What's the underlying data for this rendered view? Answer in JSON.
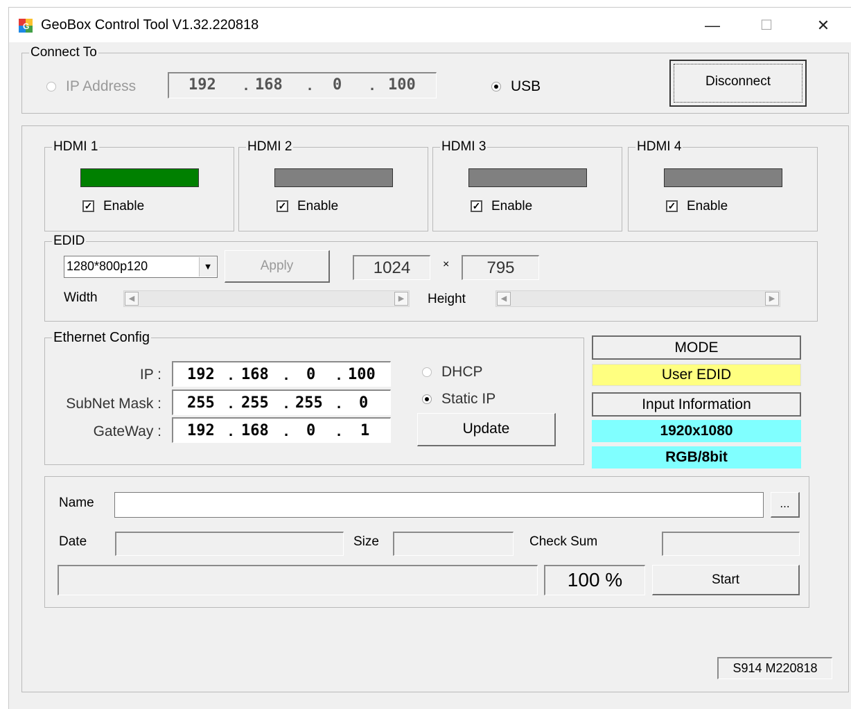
{
  "window": {
    "title": "GeoBox Control Tool  V1.32.220818",
    "minimize": "—",
    "maximize": "☐",
    "close": "✕"
  },
  "connect": {
    "legend": "Connect To",
    "ip_label": "IP Address",
    "ip": [
      "192",
      "168",
      "0",
      "100"
    ],
    "ip_selected": false,
    "usb_label": "USB",
    "usb_selected": true,
    "disconnect_label": "Disconnect"
  },
  "hdmi": [
    {
      "label": "HDMI 1",
      "enable_label": "Enable",
      "checked": true,
      "status_color": "#008000"
    },
    {
      "label": "HDMI 2",
      "enable_label": "Enable",
      "checked": true,
      "status_color": "#808080"
    },
    {
      "label": "HDMI 3",
      "enable_label": "Enable",
      "checked": true,
      "status_color": "#808080"
    },
    {
      "label": "HDMI 4",
      "enable_label": "Enable",
      "checked": true,
      "status_color": "#808080"
    }
  ],
  "edid": {
    "legend": "EDID",
    "selected": "1280*800p120",
    "apply_label": "Apply",
    "width_value": "1024",
    "times": "×",
    "height_value": "795",
    "width_label": "Width",
    "height_label": "Height"
  },
  "ethernet": {
    "legend": "Ethernet Config",
    "ip_label": "IP :",
    "ip": [
      "192",
      "168",
      "0",
      "100"
    ],
    "mask_label": "SubNet Mask :",
    "mask": [
      "255",
      "255",
      "255",
      "0"
    ],
    "gateway_label": "GateWay :",
    "gateway": [
      "192",
      "168",
      "0",
      "1"
    ],
    "dhcp_label": "DHCP",
    "dhcp_selected": false,
    "static_label": "Static IP",
    "static_selected": true,
    "update_label": "Update"
  },
  "status": {
    "mode_label": "MODE",
    "mode_value": "User EDID",
    "mode_color": "#ffff80",
    "input_label": "Input Information",
    "resolution": "1920x1080",
    "color_format": "RGB/8bit",
    "info_color": "#80ffff"
  },
  "firmware": {
    "name_label": "Name",
    "name_value": "",
    "browse_label": "...",
    "date_label": "Date",
    "size_label": "Size",
    "checksum_label": "Check Sum",
    "progress_text": "100 %",
    "progress": 1.0,
    "start_label": "Start"
  },
  "version_text": "S914 M220818"
}
